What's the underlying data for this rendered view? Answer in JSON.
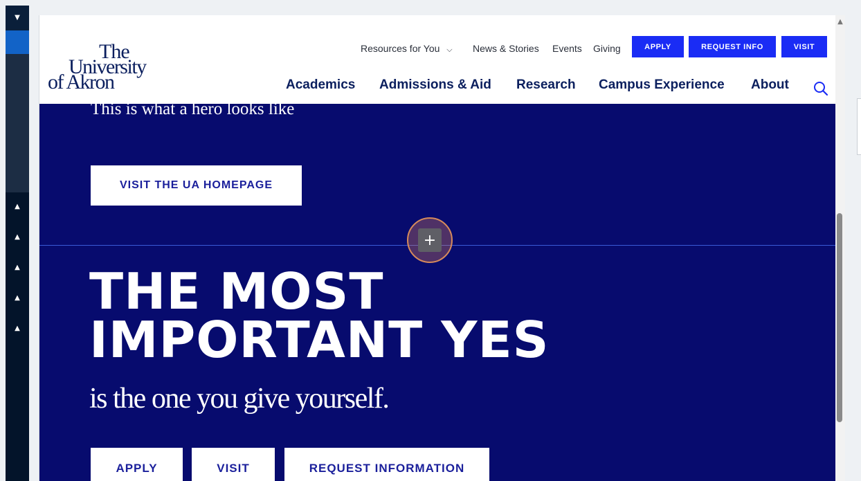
{
  "rail": {
    "collapse_icon": "caret-down",
    "expand_icon": "caret-up"
  },
  "header": {
    "logo": {
      "line1": "The",
      "line2": "University",
      "line3": "of Akron"
    },
    "utility_nav": [
      {
        "label": "Resources for You",
        "has_dropdown": true
      },
      {
        "label": "News & Stories"
      },
      {
        "label": "Events"
      },
      {
        "label": "Giving"
      }
    ],
    "utility_buttons": [
      "APPLY",
      "REQUEST INFO",
      "VISIT"
    ],
    "main_nav": [
      "Academics",
      "Admissions & Aid",
      "Research",
      "Campus Experience",
      "About"
    ],
    "search_icon": "search"
  },
  "hero": {
    "tagline": "This is what a hero looks like",
    "homepage_button": "VISIT THE UA HOMEPAGE",
    "headline_line1": "THE MOST",
    "headline_line2": "IMPORTANT YES",
    "subline": "is the one you give yourself.",
    "cta_buttons": [
      "APPLY",
      "VISIT",
      "REQUEST INFORMATION"
    ],
    "add_section_symbol": "+"
  },
  "colors": {
    "brand_blue": "#1a2cf5",
    "hero_navy": "#070b6e",
    "nav_text": "#0b1f5e",
    "button_text": "#1a1f9b",
    "editor_rail": "#03142a",
    "rail_active": "#1263c7"
  }
}
